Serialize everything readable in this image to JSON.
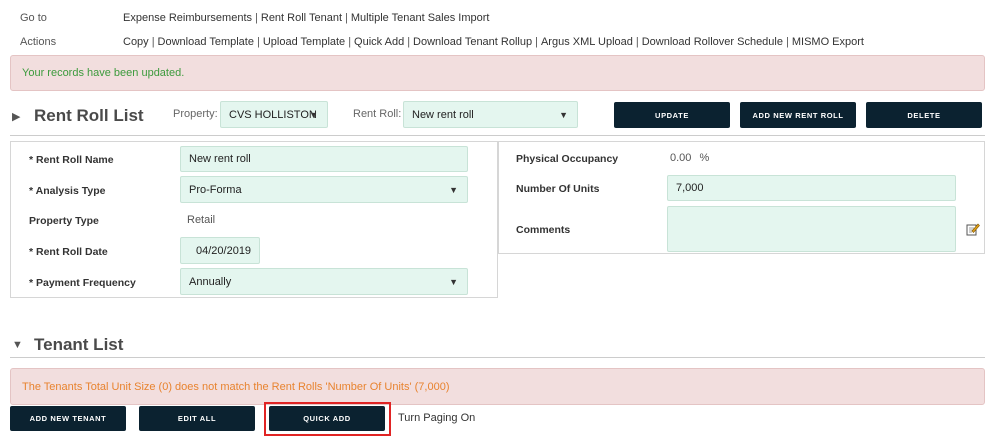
{
  "goto": {
    "label": "Go to",
    "links": [
      "Expense Reimbursements",
      "Rent Roll Tenant",
      "Multiple Tenant Sales Import"
    ]
  },
  "actions": {
    "label": "Actions",
    "links": [
      "Copy",
      "Download Template",
      "Upload Template",
      "Quick Add",
      "Download Tenant Rollup",
      "Argus XML Upload",
      "Download Rollover Schedule",
      "MISMO Export"
    ]
  },
  "alerts": {
    "success": "Your records have been updated.",
    "units_mismatch": "The Tenants Total Unit Size (0) does not match the Rent Rolls 'Number Of Units' (7,000)"
  },
  "rent_roll_list": {
    "title": "Rent Roll List",
    "toggle": "▶",
    "property_label": "Property:",
    "property_value": "CVS HOLLISTON",
    "rent_roll_label": "Rent Roll:",
    "rent_roll_value": "New rent roll",
    "buttons": {
      "update": "UPDATE",
      "add_new": "ADD NEW RENT ROLL",
      "delete": "DELETE"
    }
  },
  "form_left": {
    "rent_roll_name": {
      "label": "* Rent Roll Name",
      "value": "New rent roll"
    },
    "analysis_type": {
      "label": "* Analysis Type",
      "value": "Pro-Forma"
    },
    "property_type": {
      "label": "Property Type",
      "value": "Retail"
    },
    "rent_roll_date": {
      "label": "* Rent Roll Date",
      "value": "04/20/2019"
    },
    "payment_frequency": {
      "label": "* Payment Frequency",
      "value": "Annually"
    }
  },
  "form_right": {
    "physical_occupancy": {
      "label": "Physical Occupancy",
      "value": "0.00",
      "unit": "%"
    },
    "number_of_units": {
      "label": "Number Of Units",
      "value": "7,000"
    },
    "comments": {
      "label": "Comments",
      "value": ""
    }
  },
  "tenant_list": {
    "title": "Tenant List",
    "toggle": "▼",
    "buttons": {
      "add_new": "ADD NEW TENANT",
      "edit_all": "EDIT ALL",
      "quick_add": "QUICK ADD"
    },
    "paging_link": "Turn Paging On"
  },
  "colors": {
    "accent_dark": "#0b2230",
    "input_teal": "#e4f6ef",
    "alert_bg": "#f2dede",
    "success_text": "#3c9a3c",
    "warning_text": "#e8832f",
    "highlight": "#e02424"
  }
}
